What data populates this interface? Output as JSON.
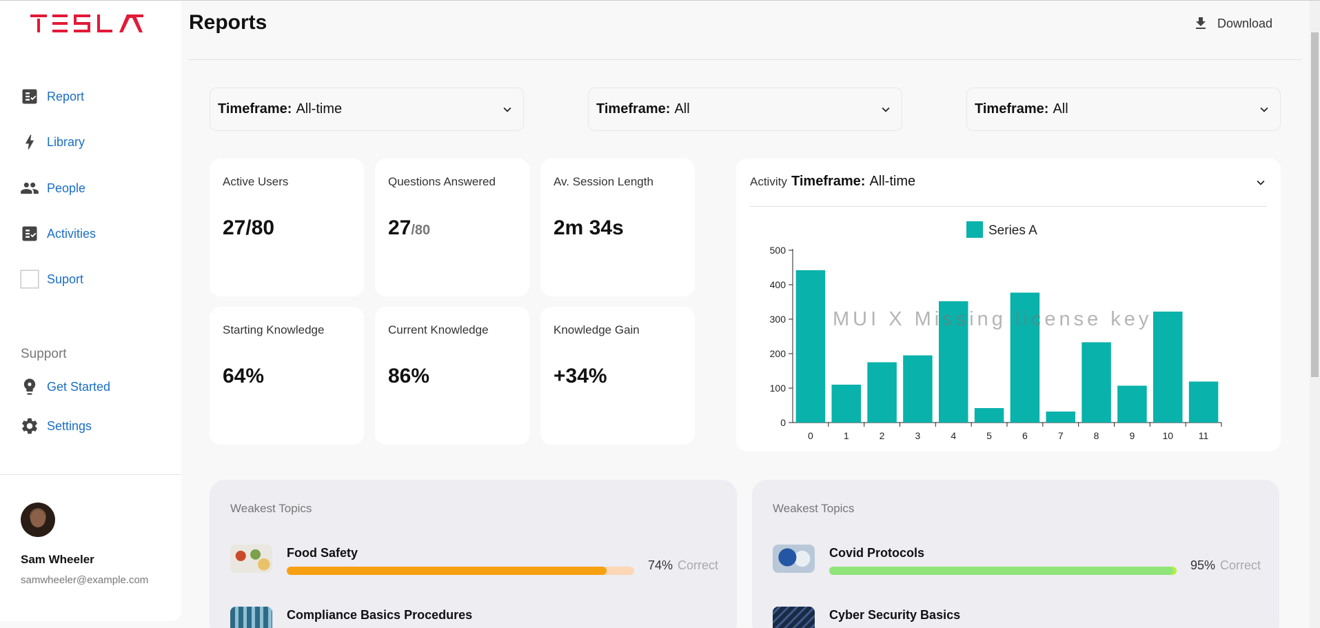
{
  "app": {
    "logo_text": "TESLA",
    "brand_color": "#e31937"
  },
  "sidebar": {
    "nav": [
      {
        "label": "Report",
        "icon": "checklist-icon"
      },
      {
        "label": "Library",
        "icon": "bolt-icon"
      },
      {
        "label": "People",
        "icon": "people-icon"
      },
      {
        "label": "Activities",
        "icon": "checklist-icon"
      },
      {
        "label": "Suport",
        "icon": "blank-square-icon"
      }
    ],
    "support_heading": "Support",
    "support_items": [
      {
        "label": "Get Started",
        "icon": "lightbulb-icon"
      },
      {
        "label": "Settings",
        "icon": "gear-icon"
      }
    ],
    "user": {
      "name": "Sam Wheeler",
      "email": "samwheeler@example.com"
    }
  },
  "header": {
    "title": "Reports",
    "download_label": "Download"
  },
  "filters": [
    {
      "label": "Timeframe:",
      "value": "All-time"
    },
    {
      "label": "Timeframe:",
      "value": "All"
    },
    {
      "label": "Timeframe:",
      "value": "All"
    }
  ],
  "stats": [
    {
      "title": "Active Users",
      "value": "27/80",
      "sub": ""
    },
    {
      "title": "Questions Answered",
      "value": "27",
      "sub": "/80"
    },
    {
      "title": "Av. Session Length",
      "value": "2m 34s",
      "sub": ""
    },
    {
      "title": "Starting Knowledge",
      "value": "64%",
      "sub": ""
    },
    {
      "title": "Current Knowledge",
      "value": "86%",
      "sub": ""
    },
    {
      "title": "Knowledge Gain",
      "value": "+34%",
      "sub": ""
    }
  ],
  "activity": {
    "label": "Activity",
    "filter_label": "Timeframe:",
    "filter_value": "All-time",
    "watermark": "MUI X Missing license key"
  },
  "chart_data": {
    "type": "bar",
    "categories": [
      "0",
      "1",
      "2",
      "3",
      "4",
      "5",
      "6",
      "7",
      "8",
      "9",
      "10",
      "11"
    ],
    "series": [
      {
        "name": "Series A",
        "values": [
          442,
          110,
          175,
          195,
          352,
          42,
          377,
          32,
          233,
          107,
          322,
          119
        ],
        "color": "#09b2aa"
      }
    ],
    "yticks": [
      0,
      100,
      200,
      300,
      400,
      500
    ],
    "ylim": [
      0,
      500
    ],
    "legend": "top-center"
  },
  "weakest": [
    {
      "title": "Weakest Topics",
      "topics": [
        {
          "name": "Food Safety",
          "pct": "74%",
          "correct_label": "Correct",
          "fill": 0.92,
          "bar_color": "#f7a011",
          "track_color": "#fdd7b6",
          "thumb": "food-thumbnail"
        },
        {
          "name": "Compliance Basics Procedures",
          "pct": "",
          "correct_label": "",
          "fill": 0.5,
          "bar_color": "#f7a011",
          "track_color": "#fdd7b6",
          "thumb": "bottles-thumbnail"
        }
      ]
    },
    {
      "title": "Weakest Topics",
      "topics": [
        {
          "name": "Covid Protocols",
          "pct": "95%",
          "correct_label": "Correct",
          "fill": 0.99,
          "bar_color": "#8fe47a",
          "track_color": "#b6f03c",
          "thumb": "ppe-thumbnail"
        },
        {
          "name": "Cyber Security Basics",
          "pct": "",
          "correct_label": "",
          "fill": 0.9,
          "bar_color": "#8fe47a",
          "track_color": "#b6f03c",
          "thumb": "keyboard-thumbnail"
        }
      ]
    }
  ]
}
